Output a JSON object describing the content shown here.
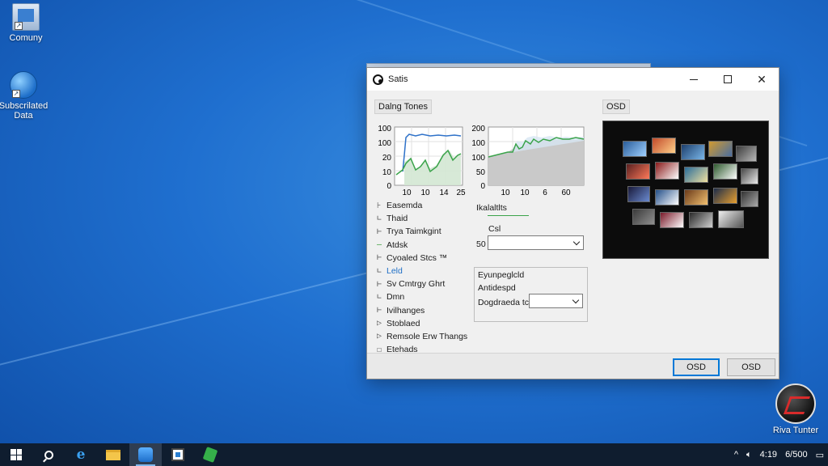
{
  "desktop": {
    "icons": [
      {
        "label": "Comuny",
        "icon": "computer-icon"
      },
      {
        "label": "Subscrilated Data",
        "icon": "globe-icon"
      }
    ],
    "riva_icon": {
      "label": "Riva Tunter",
      "icon": "riva-tuner-icon"
    }
  },
  "window": {
    "title": "Satis",
    "left_section_label": "Dalng Tones",
    "osd_label": "OSD",
    "chart_left": {
      "y_ticks": [
        "100",
        "100",
        "20",
        "10",
        "0"
      ],
      "x_ticks": [
        "10",
        "10",
        "14",
        "25"
      ]
    },
    "chart_right": {
      "y_ticks": [
        "200",
        "100",
        "100",
        "50",
        "0"
      ],
      "x_ticks": [
        "10",
        "10",
        "6",
        "60"
      ]
    },
    "tree_items": [
      {
        "branch": "⊦",
        "label": "Easemda",
        "style": "normal"
      },
      {
        "branch": "∟",
        "label": "Thaid",
        "style": "normal"
      },
      {
        "branch": "⊢",
        "label": "Trya Taimkgint",
        "style": "normal"
      },
      {
        "branch": "—",
        "label": "Atdsk",
        "style": "green"
      },
      {
        "branch": "⊢",
        "label": "Cyoaled Stcs ™",
        "style": "normal"
      },
      {
        "branch": "∟",
        "label": "Leld",
        "style": "blue"
      },
      {
        "branch": "⊢",
        "label": "Sv Cmtrgy Ghrt",
        "style": "normal"
      },
      {
        "branch": "∟",
        "label": "Dmn",
        "style": "normal"
      },
      {
        "branch": "⊢",
        "label": "Ivilhanges",
        "style": "normal"
      },
      {
        "branch": "▷",
        "label": "Stoblaed",
        "style": "normal"
      },
      {
        "branch": "▷",
        "label": "Remsole Erw Thangs",
        "style": "normal"
      },
      {
        "branch": "☐",
        "label": "Etehads",
        "style": "normal"
      }
    ],
    "mid_label_1": "Ikalaltlts",
    "mid_label_2": "Csl",
    "mid_value_label": "50",
    "group": {
      "line1": "Eyunpeglcld",
      "line2": "Antidespd",
      "field_label": "Dogdraeda tc"
    },
    "buttons": {
      "ok": "OSD",
      "cancel": "OSD"
    }
  },
  "taskbar": {
    "items": [
      "start",
      "search",
      "edge",
      "file-explorer",
      "blue-app",
      "store",
      "green-app"
    ],
    "tray_arrow": "^",
    "tray_time_1": "4:19",
    "tray_time_2": "6/500"
  }
}
